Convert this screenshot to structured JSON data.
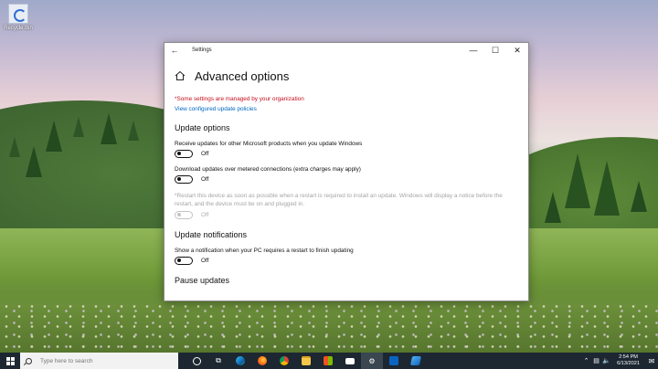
{
  "desktop": {
    "icon_label": "Recycle Bin"
  },
  "window": {
    "title": "Settings",
    "page_title": "Advanced options",
    "warning": "*Some settings are managed by your organization",
    "policies_link": "View configured update policies",
    "update_options": {
      "heading": "Update options",
      "options": [
        {
          "label": "Receive updates for other Microsoft products when you update Windows",
          "state": "Off",
          "enabled": true
        },
        {
          "label": "Download updates over metered connections (extra charges may apply)",
          "state": "Off",
          "enabled": true
        },
        {
          "label": "*Restart this device as soon as possible when a restart is required to install an update. Windows will display a notice before the restart, and the device must be on and plugged in.",
          "state": "Off",
          "enabled": false
        }
      ]
    },
    "update_notifications": {
      "heading": "Update notifications",
      "options": [
        {
          "label": "Show a notification when your PC requires a restart to finish updating",
          "state": "Off",
          "enabled": true
        }
      ]
    },
    "pause_heading": "Pause updates"
  },
  "taskbar": {
    "search_placeholder": "Type here to search",
    "pinned_apps": [
      "task-view-icon",
      "edge-icon",
      "firefox-icon",
      "chrome-icon",
      "file-explorer-icon",
      "store-icon",
      "mail-icon",
      "settings-icon",
      "outlook-icon",
      "azure-icon"
    ],
    "clock_time": "2:54 PM",
    "clock_date": "6/13/2021"
  },
  "colors": {
    "warning": "#c50f1f",
    "link": "#0067c0",
    "taskbar": "#1c2731"
  }
}
